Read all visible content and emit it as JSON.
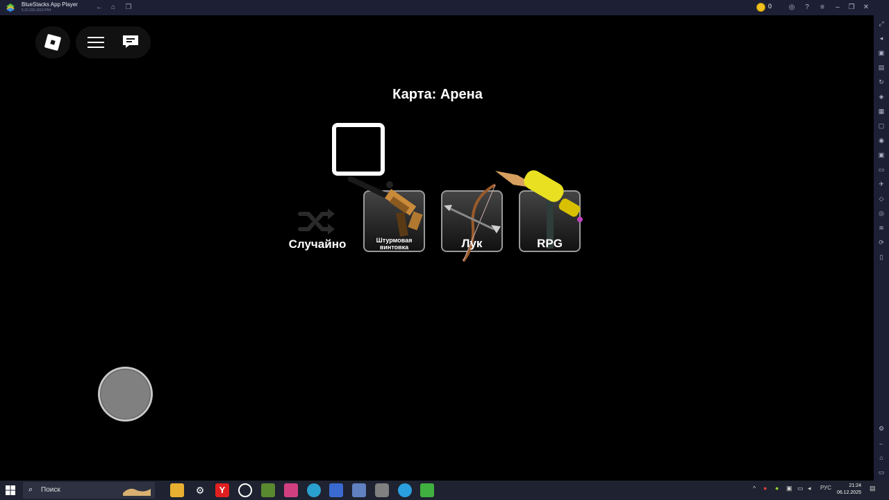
{
  "window": {
    "title": "BlueStacks App Player",
    "subtitle": "5.22.150.1016 P64"
  },
  "coins": "0",
  "game": {
    "map_title": "Карта: Арена",
    "random_label": "Случайно",
    "weapons": [
      {
        "label_line1": "Штурмовая",
        "label_line2": "винтовка"
      },
      {
        "label": "Лук"
      },
      {
        "label": "RPG"
      }
    ]
  },
  "taskbar": {
    "search_placeholder": "Поиск",
    "lang": "РУС",
    "time": "21:24",
    "date": "06.12.2025"
  },
  "colors": {
    "titlebar": "#1d2035",
    "taskbar": "#1f2230",
    "accent": "#f0c020"
  }
}
